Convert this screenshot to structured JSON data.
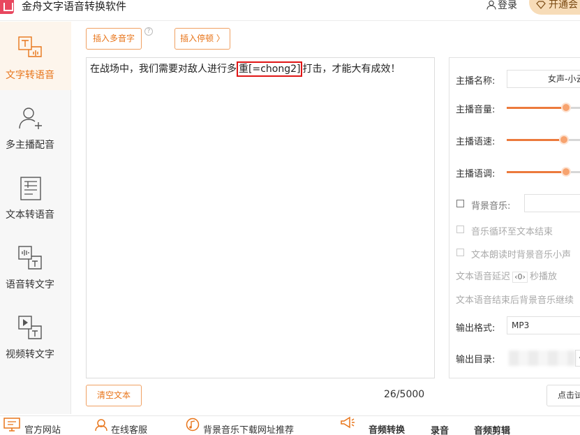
{
  "app": {
    "title": "金舟文字语音转换软件"
  },
  "header": {
    "login_label": "登录",
    "vip_label": "开通会"
  },
  "sidebar": {
    "items": [
      {
        "label": "文字转语音",
        "icon": "text-to-speech-icon",
        "active": true
      },
      {
        "label": "多主播配音",
        "icon": "user-add-icon",
        "active": false
      },
      {
        "label": "文本转语音",
        "icon": "document-icon",
        "active": false
      },
      {
        "label": "语音转文字",
        "icon": "speech-to-text-icon",
        "active": false
      },
      {
        "label": "视频转文字",
        "icon": "video-to-text-icon",
        "active": false
      }
    ]
  },
  "toolbar": {
    "insert_polyphone_label": "插入多音字",
    "insert_pause_label": "插入停顿 〉"
  },
  "editor": {
    "text_before": "在战场中，我们需要对敌人进行多",
    "highlight": "重[=chong2]",
    "text_after": "打击，才能大有成效！",
    "clear_label": "清空文本",
    "counter": "26/5000"
  },
  "settings": {
    "anchor_name_label": "主播名称:",
    "anchor_name_value": "女声-小云",
    "volume_label": "主播音量:",
    "volume_value": 0.65,
    "speed_label": "主播语速:",
    "speed_value": 0.63,
    "pitch_label": "主播语调:",
    "pitch_value": 0.65,
    "bgm_label": "背景音乐:",
    "bgm_loop_label": "音乐循环至文本结束",
    "bgm_quiet_label": "文本朗读时背景音乐小声",
    "delay_prefix": "文本语音延迟",
    "delay_value": "0",
    "delay_suffix": "秒播放",
    "bgm_continue_label": "文本语音结束后背景音乐继续",
    "format_label": "输出格式:",
    "format_value": "MP3",
    "output_dir_label": "输出目录:",
    "convert_label": "点击试"
  },
  "footer": {
    "website_label": "官方网站",
    "service_label": "在线客服",
    "bgm_download_label": "背景音乐下载网址推荐",
    "audio_convert_label": "音频转换",
    "record_label": "录音",
    "audio_edit_label": "音频剪辑"
  },
  "colors": {
    "accent": "#e8751a",
    "highlight_border": "#e01515",
    "slider": "#ec7a3c"
  }
}
